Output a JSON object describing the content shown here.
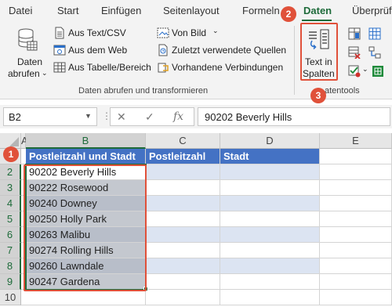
{
  "tabs": [
    "Datei",
    "Start",
    "Einfügen",
    "Seitenlayout",
    "Formeln",
    "Daten",
    "Überprüfen"
  ],
  "ribbon": {
    "get_data": {
      "line1": "Daten",
      "line2": "abrufen"
    },
    "from_text_csv": "Aus Text/CSV",
    "from_web": "Aus dem Web",
    "from_table": "Aus Tabelle/Bereich",
    "from_picture": "Von Bild",
    "recent_sources": "Zuletzt verwendete Quellen",
    "existing_connections": "Vorhandene Verbindungen",
    "group_get_transform": "Daten abrufen und transformieren",
    "text_to_columns": {
      "line1": "Text in",
      "line2": "Spalten"
    },
    "group_data_tools": "atentools"
  },
  "formula_bar": {
    "name_box": "B2",
    "fx": "fx",
    "cancel": "✕",
    "enter": "✓",
    "formula": "90202 Beverly Hills"
  },
  "grid": {
    "columns": [
      "A",
      "B",
      "C",
      "D",
      "E"
    ],
    "rows": [
      "1",
      "2",
      "3",
      "4",
      "5",
      "6",
      "7",
      "8",
      "9",
      "10"
    ],
    "headers": [
      "Postleitzahl und Stadt",
      "Postleitzahl",
      "Stadt"
    ],
    "data": [
      "90202 Beverly Hills",
      "90222 Rosewood",
      "90240 Downey",
      "90250 Holly Park",
      "90263 Malibu",
      "90274 Rolling Hills",
      "90260 Lawndale",
      "90247 Gardena"
    ]
  },
  "callouts": [
    "1",
    "2",
    "3"
  ],
  "colors": {
    "excel_green": "#1e6b3a",
    "header_blue": "#4472c4",
    "band_blue": "#dce4f2",
    "callout_red": "#e0513a"
  }
}
